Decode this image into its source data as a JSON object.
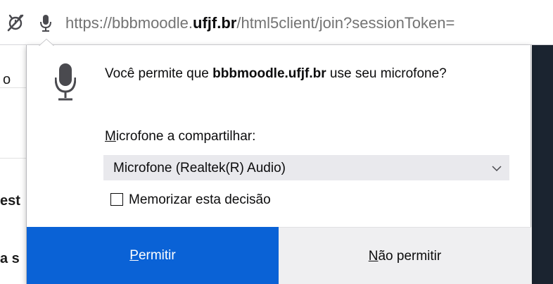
{
  "urlbar": {
    "permissions_icon": "permissions-blocked-icon",
    "mic_icon": "microphone-icon",
    "url_prefix": "https://bbbmoodle.",
    "url_domain": "ufjf.br",
    "url_path": "/html5client/join?sessionToken="
  },
  "background_page": {
    "fragment_1": "o",
    "fragment_2": "est",
    "fragment_3": "a s",
    "dark_panel_color": "#1b2430"
  },
  "popup": {
    "icon": "microphone-icon",
    "question_prefix": "Você permite que ",
    "question_site": "bbbmoodle.ufjf.br",
    "question_suffix": " use seu microfone?",
    "select_label_accesskey": "M",
    "select_label_rest": "icrofone a compartilhar:",
    "select_value": "Microfone (Realtek(R) Audio)",
    "select_chevron_icon": "chevron-down-icon",
    "remember_label": "Memorizar esta decisão",
    "remember_checked": false,
    "allow_accesskey": "P",
    "allow_rest": "ermitir",
    "deny_accesskey": "N",
    "deny_rest": "ão permitir",
    "allow_color": "#0a62d6"
  }
}
